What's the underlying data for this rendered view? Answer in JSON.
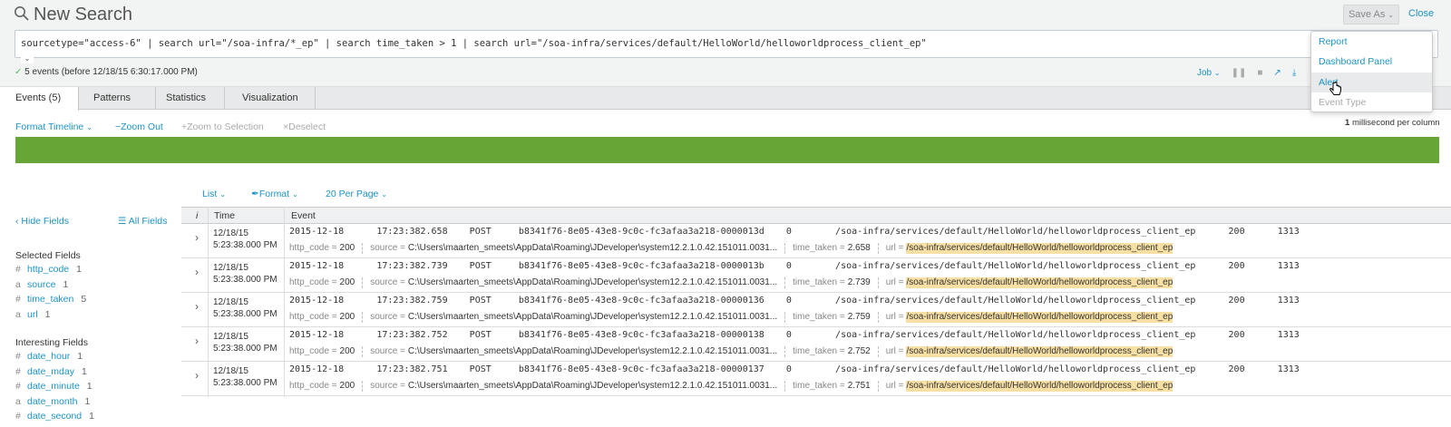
{
  "header": {
    "title": "New Search",
    "save_as_label": "Save As",
    "close_label": "Close"
  },
  "search": {
    "query": "sourcetype=\"access-6\" | search url=\"/soa-infra/*_ep\" | search time_taken > 1 | search url=\"/soa-infra/services/default/HelloWorld/helloworldprocess_client_ep\""
  },
  "status": {
    "text": "5 events (before 12/18/15 6:30:17.000 PM)"
  },
  "job_controls": {
    "job_label": "Job"
  },
  "save_as_menu": {
    "items": [
      {
        "label": "Report"
      },
      {
        "label": "Dashboard Panel"
      },
      {
        "label": "Alert"
      },
      {
        "label": "Event Type"
      }
    ]
  },
  "tabs": [
    {
      "label": "Events (5)"
    },
    {
      "label": "Patterns"
    },
    {
      "label": "Statistics"
    },
    {
      "label": "Visualization"
    }
  ],
  "timeline": {
    "format_label": "Format Timeline",
    "zoom_out_label": "Zoom Out",
    "zoom_selection_label": "Zoom to Selection",
    "deselect_label": "Deselect",
    "scale_count": "1",
    "scale_text": "millisecond per column",
    "bar_color": "#65a637"
  },
  "list_controls": {
    "list_label": "List",
    "format_label": "Format",
    "per_page_label": "20 Per Page"
  },
  "sidebar": {
    "hide_fields_label": "Hide Fields",
    "all_fields_label": "All Fields",
    "selected_heading": "Selected Fields",
    "selected_fields": [
      {
        "type": "#",
        "name": "http_code",
        "count": "1"
      },
      {
        "type": "a",
        "name": "source",
        "count": "1"
      },
      {
        "type": "#",
        "name": "time_taken",
        "count": "5"
      },
      {
        "type": "a",
        "name": "url",
        "count": "1"
      }
    ],
    "interesting_heading": "Interesting Fields",
    "interesting_fields": [
      {
        "type": "#",
        "name": "date_hour",
        "count": "1"
      },
      {
        "type": "#",
        "name": "date_mday",
        "count": "1"
      },
      {
        "type": "#",
        "name": "date_minute",
        "count": "1"
      },
      {
        "type": "a",
        "name": "date_month",
        "count": "1"
      },
      {
        "type": "#",
        "name": "date_second",
        "count": "1"
      }
    ]
  },
  "results": {
    "columns": [
      "i",
      "Time",
      "Event"
    ],
    "rows": [
      {
        "date": "12/18/15",
        "time": "5:23:38.000 PM",
        "event": "2015-12-18      17:23:382.658    POST     b8341f76-8e05-43e8-9c0c-fc3afaa3a218-0000013d    0        /soa-infra/services/default/HelloWorld/helloworldprocess_client_ep      200      1313",
        "http_code": "200",
        "source": "C:\\Users\\maarten_smeets\\AppData\\Roaming\\JDeveloper\\system12.2.1.0.42.151011.0031...",
        "time_taken": "2.658",
        "url": "/soa-infra/services/default/HelloWorld/helloworldprocess_client_ep"
      },
      {
        "date": "12/18/15",
        "time": "5:23:38.000 PM",
        "event": "2015-12-18      17:23:382.739    POST     b8341f76-8e05-43e8-9c0c-fc3afaa3a218-0000013b    0        /soa-infra/services/default/HelloWorld/helloworldprocess_client_ep      200      1313",
        "http_code": "200",
        "source": "C:\\Users\\maarten_smeets\\AppData\\Roaming\\JDeveloper\\system12.2.1.0.42.151011.0031...",
        "time_taken": "2.739",
        "url": "/soa-infra/services/default/HelloWorld/helloworldprocess_client_ep"
      },
      {
        "date": "12/18/15",
        "time": "5:23:38.000 PM",
        "event": "2015-12-18      17:23:382.759    POST     b8341f76-8e05-43e8-9c0c-fc3afaa3a218-00000136    0        /soa-infra/services/default/HelloWorld/helloworldprocess_client_ep      200      1313",
        "http_code": "200",
        "source": "C:\\Users\\maarten_smeets\\AppData\\Roaming\\JDeveloper\\system12.2.1.0.42.151011.0031...",
        "time_taken": "2.759",
        "url": "/soa-infra/services/default/HelloWorld/helloworldprocess_client_ep"
      },
      {
        "date": "12/18/15",
        "time": "5:23:38.000 PM",
        "event": "2015-12-18      17:23:382.752    POST     b8341f76-8e05-43e8-9c0c-fc3afaa3a218-00000138    0        /soa-infra/services/default/HelloWorld/helloworldprocess_client_ep      200      1313",
        "http_code": "200",
        "source": "C:\\Users\\maarten_smeets\\AppData\\Roaming\\JDeveloper\\system12.2.1.0.42.151011.0031...",
        "time_taken": "2.752",
        "url": "/soa-infra/services/default/HelloWorld/helloworldprocess_client_ep"
      },
      {
        "date": "12/18/15",
        "time": "5:23:38.000 PM",
        "event": "2015-12-18      17:23:382.751    POST     b8341f76-8e05-43e8-9c0c-fc3afaa3a218-00000137    0        /soa-infra/services/default/HelloWorld/helloworldprocess_client_ep      200      1313",
        "http_code": "200",
        "source": "C:\\Users\\maarten_smeets\\AppData\\Roaming\\JDeveloper\\system12.2.1.0.42.151011.0031...",
        "time_taken": "2.751",
        "url": "/soa-infra/services/default/HelloWorld/helloworldprocess_client_ep"
      }
    ],
    "field_labels": {
      "http_code": "http_code =",
      "source": "source =",
      "time_taken": "time_taken =",
      "url": "url ="
    }
  }
}
